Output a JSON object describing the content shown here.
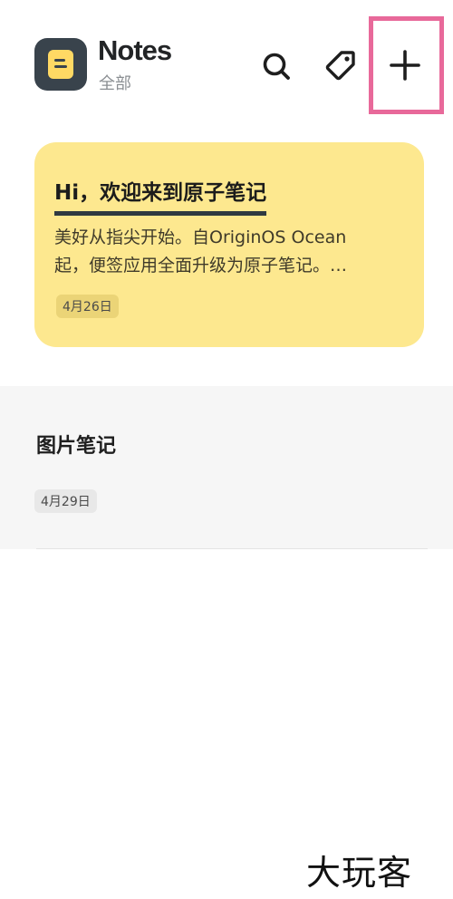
{
  "header": {
    "app_title": "Notes",
    "folder_label": "全部",
    "icons": {
      "logo": "notes-app-icon",
      "search": "search-icon",
      "tag": "tag-icon",
      "add": "plus-icon"
    },
    "highlight_color": "#e8699a"
  },
  "notes": [
    {
      "title": "Hi，欢迎来到原子笔记",
      "body_lines": [
        "美好从指尖开始。自OriginOS Ocean",
        "起，便签应用全面升级为原子笔记。…"
      ],
      "date": "4月26日",
      "color": "#fde88f"
    },
    {
      "title": "图片笔记",
      "date": "4月29日",
      "color": "#f6f6f6"
    }
  ],
  "watermark": "大玩客"
}
